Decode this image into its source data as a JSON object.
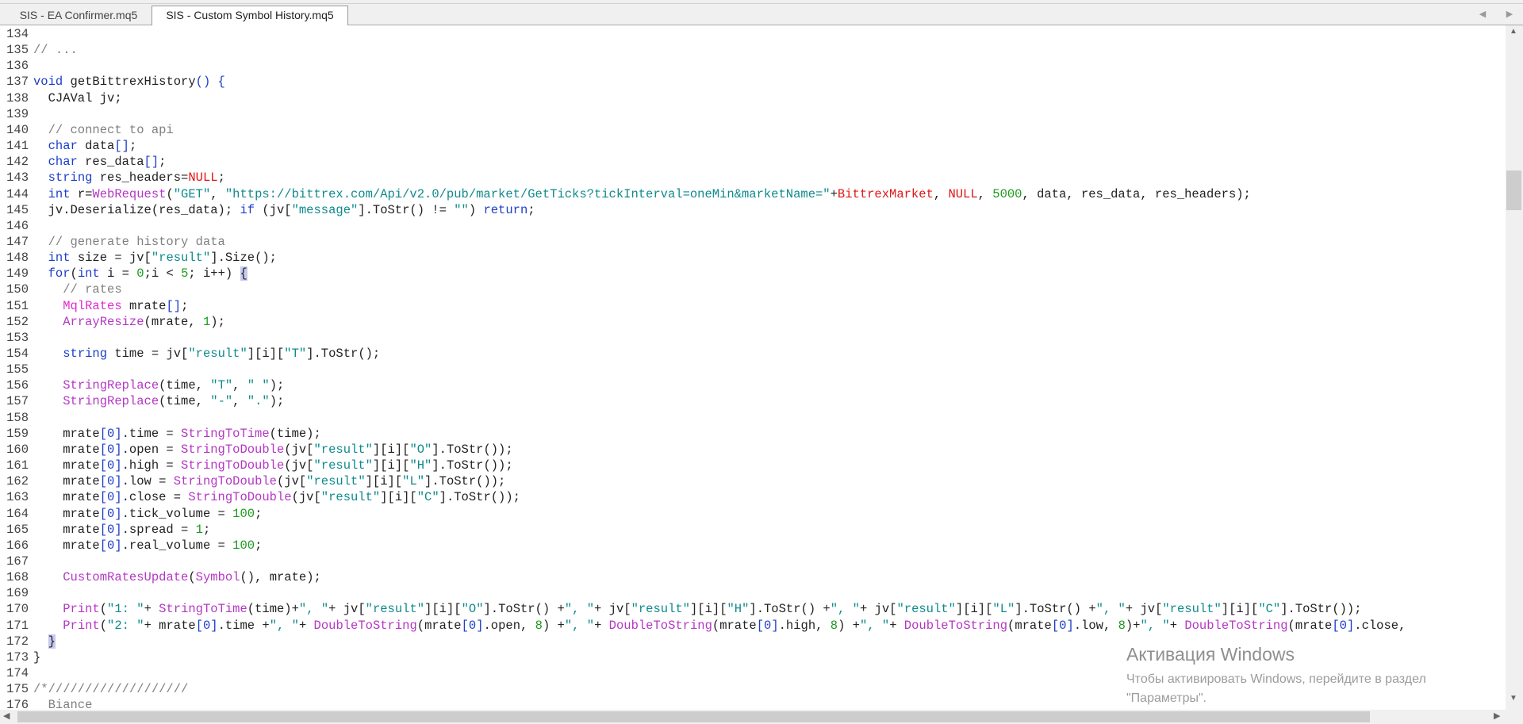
{
  "tabs": [
    {
      "label": "SIS - EA Confirmer.mq5"
    },
    {
      "label": "SIS - Custom Symbol History.mq5"
    }
  ],
  "editor": {
    "lines": [
      {
        "n": "134",
        "segs": []
      },
      {
        "n": "135",
        "segs": [
          {
            "t": "// ...",
            "c": "c"
          }
        ]
      },
      {
        "n": "136",
        "segs": []
      },
      {
        "n": "137",
        "segs": [
          {
            "t": "void",
            "c": "k"
          },
          {
            "t": " getBittrexHistory",
            "c": ""
          },
          {
            "t": "() {",
            "c": "k"
          }
        ]
      },
      {
        "n": "138",
        "segs": [
          {
            "t": "  CJAVal jv;",
            "c": ""
          }
        ]
      },
      {
        "n": "139",
        "segs": []
      },
      {
        "n": "140",
        "segs": [
          {
            "t": "  // connect to api",
            "c": "c"
          }
        ]
      },
      {
        "n": "141",
        "segs": [
          {
            "t": "  ",
            "c": ""
          },
          {
            "t": "char",
            "c": "k"
          },
          {
            "t": " data",
            "c": ""
          },
          {
            "t": "[]",
            "c": "k"
          },
          {
            "t": ";",
            "c": ""
          }
        ]
      },
      {
        "n": "142",
        "segs": [
          {
            "t": "  ",
            "c": ""
          },
          {
            "t": "char",
            "c": "k"
          },
          {
            "t": " res_data",
            "c": ""
          },
          {
            "t": "[]",
            "c": "k"
          },
          {
            "t": ";",
            "c": ""
          }
        ]
      },
      {
        "n": "143",
        "segs": [
          {
            "t": "  ",
            "c": ""
          },
          {
            "t": "string",
            "c": "k"
          },
          {
            "t": " res_headers=",
            "c": ""
          },
          {
            "t": "NULL",
            "c": "r"
          },
          {
            "t": ";",
            "c": ""
          }
        ]
      },
      {
        "n": "144",
        "segs": [
          {
            "t": "  ",
            "c": ""
          },
          {
            "t": "int",
            "c": "k"
          },
          {
            "t": " r=",
            "c": ""
          },
          {
            "t": "WebRequest",
            "c": "f"
          },
          {
            "t": "(",
            "c": ""
          },
          {
            "t": "\"GET\"",
            "c": "s"
          },
          {
            "t": ", ",
            "c": ""
          },
          {
            "t": "\"https://bittrex.com/Api/v2.0/pub/market/GetTicks?tickInterval=oneMin&marketName=\"",
            "c": "s"
          },
          {
            "t": "+",
            "c": ""
          },
          {
            "t": "BittrexMarket",
            "c": "r"
          },
          {
            "t": ", ",
            "c": ""
          },
          {
            "t": "NULL",
            "c": "r"
          },
          {
            "t": ", ",
            "c": ""
          },
          {
            "t": "5000",
            "c": "n"
          },
          {
            "t": ", data, res_data, res_headers);",
            "c": ""
          }
        ]
      },
      {
        "n": "145",
        "segs": [
          {
            "t": "  jv.Deserialize(res_data); ",
            "c": ""
          },
          {
            "t": "if",
            "c": "k"
          },
          {
            "t": " (jv[",
            "c": ""
          },
          {
            "t": "\"message\"",
            "c": "s"
          },
          {
            "t": "].ToStr() != ",
            "c": ""
          },
          {
            "t": "\"\"",
            "c": "s"
          },
          {
            "t": ") ",
            "c": ""
          },
          {
            "t": "return",
            "c": "k"
          },
          {
            "t": ";",
            "c": ""
          }
        ]
      },
      {
        "n": "146",
        "segs": []
      },
      {
        "n": "147",
        "segs": [
          {
            "t": "  // generate history data",
            "c": "c"
          }
        ]
      },
      {
        "n": "148",
        "segs": [
          {
            "t": "  ",
            "c": ""
          },
          {
            "t": "int",
            "c": "k"
          },
          {
            "t": " size = jv[",
            "c": ""
          },
          {
            "t": "\"result\"",
            "c": "s"
          },
          {
            "t": "].Size();",
            "c": ""
          }
        ]
      },
      {
        "n": "149",
        "segs": [
          {
            "t": "  ",
            "c": ""
          },
          {
            "t": "for",
            "c": "k"
          },
          {
            "t": "(",
            "c": ""
          },
          {
            "t": "int",
            "c": "k"
          },
          {
            "t": " i = ",
            "c": ""
          },
          {
            "t": "0",
            "c": "n"
          },
          {
            "t": ";i < ",
            "c": ""
          },
          {
            "t": "5",
            "c": "n"
          },
          {
            "t": "; i++) ",
            "c": ""
          },
          {
            "t": "{",
            "c": "br"
          }
        ]
      },
      {
        "n": "150",
        "segs": [
          {
            "t": "    // rates",
            "c": "c"
          }
        ]
      },
      {
        "n": "151",
        "segs": [
          {
            "t": "    ",
            "c": ""
          },
          {
            "t": "MqlRates",
            "c": "t"
          },
          {
            "t": " mrate",
            "c": ""
          },
          {
            "t": "[]",
            "c": "k"
          },
          {
            "t": ";",
            "c": ""
          }
        ]
      },
      {
        "n": "152",
        "segs": [
          {
            "t": "    ",
            "c": ""
          },
          {
            "t": "ArrayResize",
            "c": "f"
          },
          {
            "t": "(mrate, ",
            "c": ""
          },
          {
            "t": "1",
            "c": "n"
          },
          {
            "t": ");",
            "c": ""
          }
        ]
      },
      {
        "n": "153",
        "segs": []
      },
      {
        "n": "154",
        "segs": [
          {
            "t": "    ",
            "c": ""
          },
          {
            "t": "string",
            "c": "k"
          },
          {
            "t": " time = jv[",
            "c": ""
          },
          {
            "t": "\"result\"",
            "c": "s"
          },
          {
            "t": "][i][",
            "c": ""
          },
          {
            "t": "\"T\"",
            "c": "s"
          },
          {
            "t": "].ToStr();",
            "c": ""
          }
        ]
      },
      {
        "n": "155",
        "segs": []
      },
      {
        "n": "156",
        "segs": [
          {
            "t": "    ",
            "c": ""
          },
          {
            "t": "StringReplace",
            "c": "f"
          },
          {
            "t": "(time, ",
            "c": ""
          },
          {
            "t": "\"T\"",
            "c": "s"
          },
          {
            "t": ", ",
            "c": ""
          },
          {
            "t": "\" \"",
            "c": "s"
          },
          {
            "t": ");",
            "c": ""
          }
        ]
      },
      {
        "n": "157",
        "segs": [
          {
            "t": "    ",
            "c": ""
          },
          {
            "t": "StringReplace",
            "c": "f"
          },
          {
            "t": "(time, ",
            "c": ""
          },
          {
            "t": "\"-\"",
            "c": "s"
          },
          {
            "t": ", ",
            "c": ""
          },
          {
            "t": "\".\"",
            "c": "s"
          },
          {
            "t": ");",
            "c": ""
          }
        ]
      },
      {
        "n": "158",
        "segs": []
      },
      {
        "n": "159",
        "segs": [
          {
            "t": "    mrate",
            "c": ""
          },
          {
            "t": "[0]",
            "c": "k"
          },
          {
            "t": ".time = ",
            "c": ""
          },
          {
            "t": "StringToTime",
            "c": "f"
          },
          {
            "t": "(time);",
            "c": ""
          }
        ]
      },
      {
        "n": "160",
        "segs": [
          {
            "t": "    mrate",
            "c": ""
          },
          {
            "t": "[0]",
            "c": "k"
          },
          {
            "t": ".open = ",
            "c": ""
          },
          {
            "t": "StringToDouble",
            "c": "f"
          },
          {
            "t": "(jv[",
            "c": ""
          },
          {
            "t": "\"result\"",
            "c": "s"
          },
          {
            "t": "][i][",
            "c": ""
          },
          {
            "t": "\"O\"",
            "c": "s"
          },
          {
            "t": "].ToStr());",
            "c": ""
          }
        ]
      },
      {
        "n": "161",
        "segs": [
          {
            "t": "    mrate",
            "c": ""
          },
          {
            "t": "[0]",
            "c": "k"
          },
          {
            "t": ".high = ",
            "c": ""
          },
          {
            "t": "StringToDouble",
            "c": "f"
          },
          {
            "t": "(jv[",
            "c": ""
          },
          {
            "t": "\"result\"",
            "c": "s"
          },
          {
            "t": "][i][",
            "c": ""
          },
          {
            "t": "\"H\"",
            "c": "s"
          },
          {
            "t": "].ToStr());",
            "c": ""
          }
        ]
      },
      {
        "n": "162",
        "segs": [
          {
            "t": "    mrate",
            "c": ""
          },
          {
            "t": "[0]",
            "c": "k"
          },
          {
            "t": ".low = ",
            "c": ""
          },
          {
            "t": "StringToDouble",
            "c": "f"
          },
          {
            "t": "(jv[",
            "c": ""
          },
          {
            "t": "\"result\"",
            "c": "s"
          },
          {
            "t": "][i][",
            "c": ""
          },
          {
            "t": "\"L\"",
            "c": "s"
          },
          {
            "t": "].ToStr());",
            "c": ""
          }
        ]
      },
      {
        "n": "163",
        "segs": [
          {
            "t": "    mrate",
            "c": ""
          },
          {
            "t": "[0]",
            "c": "k"
          },
          {
            "t": ".close = ",
            "c": ""
          },
          {
            "t": "StringToDouble",
            "c": "f"
          },
          {
            "t": "(jv[",
            "c": ""
          },
          {
            "t": "\"result\"",
            "c": "s"
          },
          {
            "t": "][i][",
            "c": ""
          },
          {
            "t": "\"C\"",
            "c": "s"
          },
          {
            "t": "].ToStr());",
            "c": ""
          }
        ]
      },
      {
        "n": "164",
        "segs": [
          {
            "t": "    mrate",
            "c": ""
          },
          {
            "t": "[0]",
            "c": "k"
          },
          {
            "t": ".tick_volume = ",
            "c": ""
          },
          {
            "t": "100",
            "c": "n"
          },
          {
            "t": ";",
            "c": ""
          }
        ]
      },
      {
        "n": "165",
        "segs": [
          {
            "t": "    mrate",
            "c": ""
          },
          {
            "t": "[0]",
            "c": "k"
          },
          {
            "t": ".spread = ",
            "c": ""
          },
          {
            "t": "1",
            "c": "n"
          },
          {
            "t": ";",
            "c": ""
          }
        ]
      },
      {
        "n": "166",
        "segs": [
          {
            "t": "    mrate",
            "c": ""
          },
          {
            "t": "[0]",
            "c": "k"
          },
          {
            "t": ".real_volume = ",
            "c": ""
          },
          {
            "t": "100",
            "c": "n"
          },
          {
            "t": ";",
            "c": ""
          }
        ]
      },
      {
        "n": "167",
        "segs": []
      },
      {
        "n": "168",
        "segs": [
          {
            "t": "    ",
            "c": ""
          },
          {
            "t": "CustomRatesUpdate",
            "c": "f"
          },
          {
            "t": "(",
            "c": ""
          },
          {
            "t": "Symbol",
            "c": "f"
          },
          {
            "t": "(), mrate);",
            "c": ""
          }
        ]
      },
      {
        "n": "169",
        "segs": []
      },
      {
        "n": "170",
        "segs": [
          {
            "t": "    ",
            "c": ""
          },
          {
            "t": "Print",
            "c": "f"
          },
          {
            "t": "(",
            "c": ""
          },
          {
            "t": "\"1: \"",
            "c": "s"
          },
          {
            "t": "+ ",
            "c": ""
          },
          {
            "t": "StringToTime",
            "c": "f"
          },
          {
            "t": "(time)+",
            "c": ""
          },
          {
            "t": "\", \"",
            "c": "s"
          },
          {
            "t": "+ jv[",
            "c": ""
          },
          {
            "t": "\"result\"",
            "c": "s"
          },
          {
            "t": "][i][",
            "c": ""
          },
          {
            "t": "\"O\"",
            "c": "s"
          },
          {
            "t": "].ToStr() +",
            "c": ""
          },
          {
            "t": "\", \"",
            "c": "s"
          },
          {
            "t": "+ jv[",
            "c": ""
          },
          {
            "t": "\"result\"",
            "c": "s"
          },
          {
            "t": "][i][",
            "c": ""
          },
          {
            "t": "\"H\"",
            "c": "s"
          },
          {
            "t": "].ToStr() +",
            "c": ""
          },
          {
            "t": "\", \"",
            "c": "s"
          },
          {
            "t": "+ jv[",
            "c": ""
          },
          {
            "t": "\"result\"",
            "c": "s"
          },
          {
            "t": "][i][",
            "c": ""
          },
          {
            "t": "\"L\"",
            "c": "s"
          },
          {
            "t": "].ToStr() +",
            "c": ""
          },
          {
            "t": "\", \"",
            "c": "s"
          },
          {
            "t": "+ jv[",
            "c": ""
          },
          {
            "t": "\"result\"",
            "c": "s"
          },
          {
            "t": "][i][",
            "c": ""
          },
          {
            "t": "\"C\"",
            "c": "s"
          },
          {
            "t": "].ToStr());",
            "c": ""
          }
        ]
      },
      {
        "n": "171",
        "segs": [
          {
            "t": "    ",
            "c": ""
          },
          {
            "t": "Print",
            "c": "f"
          },
          {
            "t": "(",
            "c": ""
          },
          {
            "t": "\"2: \"",
            "c": "s"
          },
          {
            "t": "+ mrate",
            "c": ""
          },
          {
            "t": "[0]",
            "c": "k"
          },
          {
            "t": ".time +",
            "c": ""
          },
          {
            "t": "\", \"",
            "c": "s"
          },
          {
            "t": "+ ",
            "c": ""
          },
          {
            "t": "DoubleToString",
            "c": "f"
          },
          {
            "t": "(mrate",
            "c": ""
          },
          {
            "t": "[0]",
            "c": "k"
          },
          {
            "t": ".open, ",
            "c": ""
          },
          {
            "t": "8",
            "c": "n"
          },
          {
            "t": ") +",
            "c": ""
          },
          {
            "t": "\", \"",
            "c": "s"
          },
          {
            "t": "+ ",
            "c": ""
          },
          {
            "t": "DoubleToString",
            "c": "f"
          },
          {
            "t": "(mrate",
            "c": ""
          },
          {
            "t": "[0]",
            "c": "k"
          },
          {
            "t": ".high, ",
            "c": ""
          },
          {
            "t": "8",
            "c": "n"
          },
          {
            "t": ") +",
            "c": ""
          },
          {
            "t": "\", \"",
            "c": "s"
          },
          {
            "t": "+ ",
            "c": ""
          },
          {
            "t": "DoubleToString",
            "c": "f"
          },
          {
            "t": "(mrate",
            "c": ""
          },
          {
            "t": "[0]",
            "c": "k"
          },
          {
            "t": ".low, ",
            "c": ""
          },
          {
            "t": "8",
            "c": "n"
          },
          {
            "t": ")+",
            "c": ""
          },
          {
            "t": "\", \"",
            "c": "s"
          },
          {
            "t": "+ ",
            "c": ""
          },
          {
            "t": "DoubleToString",
            "c": "f"
          },
          {
            "t": "(mrate",
            "c": ""
          },
          {
            "t": "[0]",
            "c": "k"
          },
          {
            "t": ".close,",
            "c": ""
          }
        ]
      },
      {
        "n": "172",
        "segs": [
          {
            "t": "  ",
            "c": ""
          },
          {
            "t": "}",
            "c": "br"
          }
        ]
      },
      {
        "n": "173",
        "segs": [
          {
            "t": "}",
            "c": ""
          }
        ]
      },
      {
        "n": "174",
        "segs": []
      },
      {
        "n": "175",
        "segs": [
          {
            "t": "/*///////////////////",
            "c": "c"
          }
        ]
      },
      {
        "n": "176",
        "segs": [
          {
            "t": "  Biance",
            "c": "c"
          }
        ]
      }
    ]
  },
  "scrollbars": {
    "up_icon": "▲",
    "down_icon": "▼",
    "left_icon": "◀",
    "right_icon": "▶"
  },
  "tab_nav": {
    "prev_icon": "◀",
    "next_icon": "▶"
  },
  "watermark": {
    "title": "Активация Windows",
    "line1": "Чтобы активировать Windows, перейдите в раздел",
    "line2": "\"Параметры\"."
  },
  "colors": {
    "keyword": "#1c3ec8",
    "function": "#b437c4",
    "type": "#e02ad0",
    "string": "#0f8a8c",
    "number": "#1c9a1c",
    "comment": "#808080",
    "constant": "#e01515"
  }
}
